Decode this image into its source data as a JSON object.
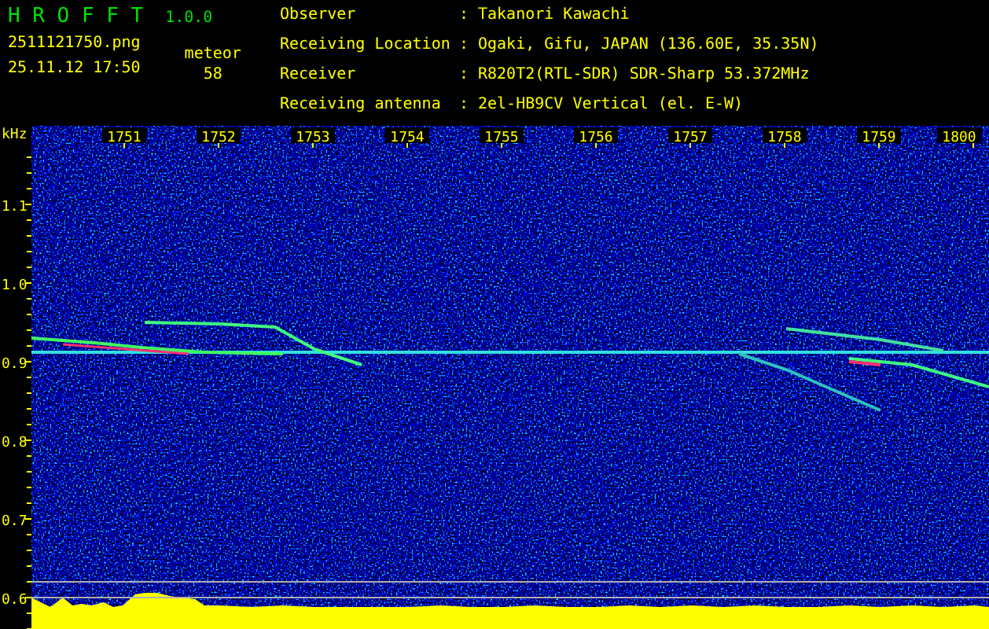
{
  "header": {
    "app_title": "H R O F F T",
    "version": "1.0.0",
    "filename": "2511121750.png",
    "datetime": "25.11.12 17:50",
    "count_label": "meteor",
    "count": "58"
  },
  "info": [
    {
      "label": "Observer",
      "separator": ":",
      "value": "Takanori Kawachi"
    },
    {
      "label": "Receiving Location",
      "separator": ":",
      "value": "Ogaki, Gifu, JAPAN (136.60E, 35.35N)"
    },
    {
      "label": "Receiver",
      "separator": ":",
      "value": "R820T2(RTL-SDR) SDR-Sharp 53.372MHz"
    },
    {
      "label": "Receiving antenna",
      "separator": ":",
      "value": "2el-HB9CV Vertical (el. E-W)"
    }
  ],
  "spectrogram": {
    "y_unit": "kHz",
    "y_ticks": [
      "1.1",
      "1.0",
      "0.9",
      "0.8",
      "0.7",
      "0.6"
    ],
    "x_ticks": [
      "1751",
      "1752",
      "1753",
      "1754",
      "1755",
      "1756",
      "1757",
      "1758",
      "1759",
      "1800"
    ]
  }
}
